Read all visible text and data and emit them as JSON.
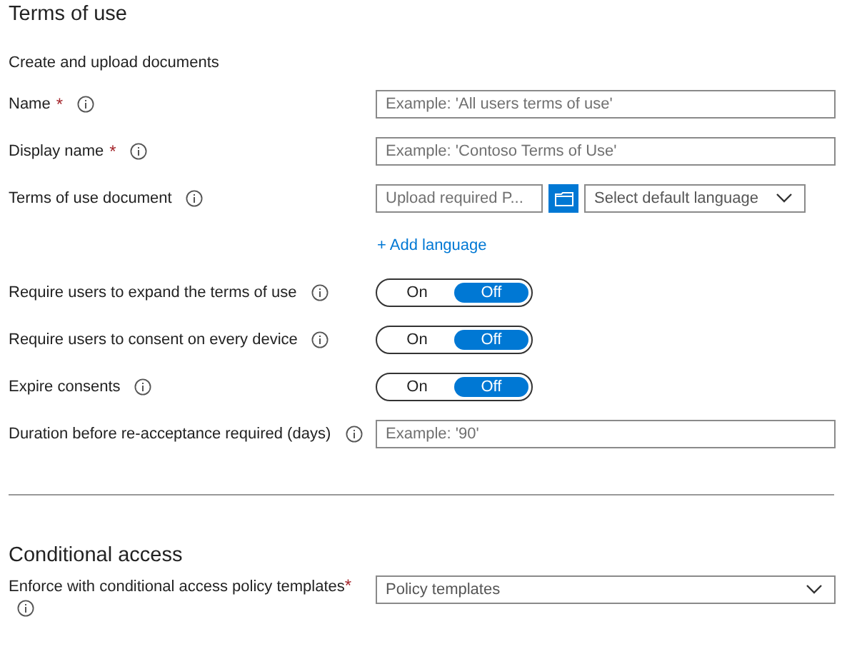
{
  "title": "Terms of use",
  "subtitle": "Create and upload documents",
  "rows": [
    {
      "kind": "text",
      "label": "Name",
      "required_mark": "*",
      "placeholder": "Example: 'All users terms of use'"
    },
    {
      "kind": "text",
      "label": "Display name",
      "required_mark": "*",
      "placeholder": "Example: 'Contoso Terms of Use'"
    },
    {
      "kind": "upload",
      "label": "Terms of use document",
      "placeholder": "Upload required P...",
      "language_placeholder": "Select default language"
    },
    {
      "kind": "link",
      "link": "+ Add language"
    },
    {
      "kind": "toggle",
      "label": "Require users to expand the terms of use",
      "options": [
        {
          "label": "On",
          "selected": false
        },
        {
          "label": "Off",
          "selected": true
        }
      ]
    },
    {
      "kind": "toggle",
      "label": "Require users to consent on every device",
      "options": [
        {
          "label": "On",
          "selected": false
        },
        {
          "label": "Off",
          "selected": true
        }
      ]
    },
    {
      "kind": "toggle",
      "label": "Expire consents",
      "options": [
        {
          "label": "On",
          "selected": false
        },
        {
          "label": "Off",
          "selected": true
        }
      ]
    },
    {
      "kind": "text",
      "label": "Duration before re-acceptance required (days)",
      "placeholder": "Example: '90'"
    }
  ],
  "conditional": {
    "title": "Conditional access",
    "label": "Enforce with conditional access policy templates",
    "required_mark": "*",
    "placeholder": "Policy templates"
  }
}
